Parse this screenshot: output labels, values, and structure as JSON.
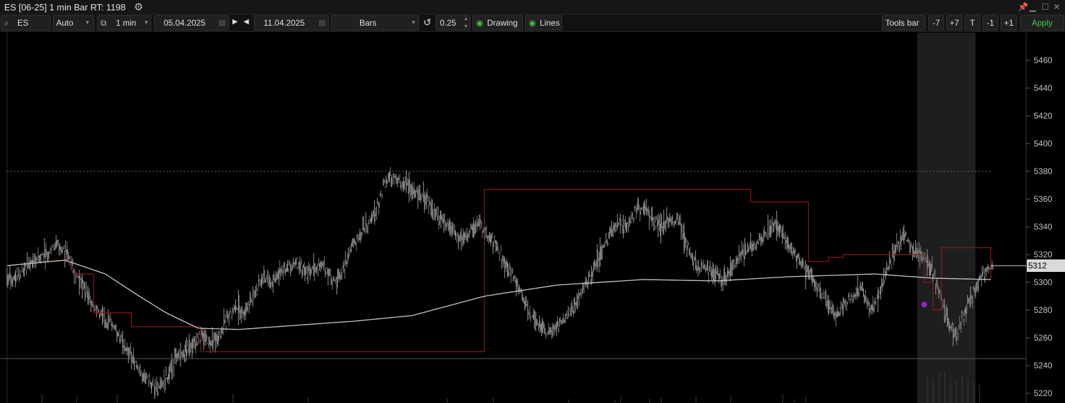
{
  "window": {
    "title": "ES [06-25] 1 min Bar RT: 1198",
    "settings_icon": "gears-icon"
  },
  "toolbar": {
    "symbol": "ES",
    "account": "Auto",
    "timeframe": "1 min",
    "date_from": "05.04.2025",
    "date_to": "11.04.2025",
    "chart_type": "Bars",
    "tick_size": "0.25",
    "drawing_label": "Drawing",
    "lines_label": "Lines",
    "tools_bar_label": "Tools bar",
    "nav_minus7": "-7",
    "nav_plus7": "+7",
    "nav_t": "T",
    "nav_minus1": "-1",
    "nav_plus1": "+1",
    "apply_label": "Apply"
  },
  "colors": {
    "background": "#000000",
    "bars": "#9a9a9a",
    "vwap": "#c8c8c8",
    "levels": "#8b1a1a",
    "session_highlight": "#1e1e1e",
    "apply_text": "#46c946",
    "marker": "#a020c0"
  },
  "chart_data": {
    "type": "bar",
    "y_axis_ticks": [
      "5460",
      "5440",
      "5420",
      "5400",
      "5380",
      "5360",
      "5340",
      "5320",
      "5300",
      "5280",
      "5260",
      "5240",
      "5220"
    ],
    "ylim": [
      5212,
      5478
    ],
    "current_price_label": "5312",
    "current_price": 5312,
    "dotted_level": 5380,
    "horizontal_level": 5245,
    "price_path": [
      [
        0,
        5302
      ],
      [
        3,
        5305
      ],
      [
        6,
        5310
      ],
      [
        10,
        5318
      ],
      [
        14,
        5321
      ],
      [
        17,
        5328
      ],
      [
        20,
        5322
      ],
      [
        23,
        5308
      ],
      [
        26,
        5298
      ],
      [
        29,
        5285
      ],
      [
        33,
        5274
      ],
      [
        37,
        5268
      ],
      [
        40,
        5255
      ],
      [
        43,
        5245
      ],
      [
        46,
        5235
      ],
      [
        49,
        5228
      ],
      [
        52,
        5222
      ],
      [
        55,
        5233
      ],
      [
        58,
        5245
      ],
      [
        61,
        5250
      ],
      [
        64,
        5256
      ],
      [
        67,
        5262
      ],
      [
        70,
        5256
      ],
      [
        73,
        5260
      ],
      [
        76,
        5275
      ],
      [
        79,
        5283
      ],
      [
        82,
        5280
      ],
      [
        85,
        5290
      ],
      [
        88,
        5304
      ],
      [
        91,
        5300
      ],
      [
        94,
        5307
      ],
      [
        97,
        5312
      ],
      [
        100,
        5314
      ],
      [
        103,
        5306
      ],
      [
        106,
        5310
      ],
      [
        109,
        5313
      ],
      [
        112,
        5300
      ],
      [
        115,
        5305
      ],
      [
        118,
        5322
      ],
      [
        121,
        5332
      ],
      [
        124,
        5342
      ],
      [
        127,
        5350
      ],
      [
        130,
        5370
      ],
      [
        133,
        5377
      ],
      [
        136,
        5372
      ],
      [
        139,
        5368
      ],
      [
        142,
        5364
      ],
      [
        145,
        5358
      ],
      [
        148,
        5350
      ],
      [
        151,
        5342
      ],
      [
        154,
        5336
      ],
      [
        157,
        5330
      ],
      [
        160,
        5338
      ],
      [
        163,
        5342
      ],
      [
        166,
        5333
      ],
      [
        169,
        5325
      ],
      [
        172,
        5312
      ],
      [
        175,
        5302
      ],
      [
        178,
        5288
      ],
      [
        181,
        5276
      ],
      [
        184,
        5268
      ],
      [
        187,
        5262
      ],
      [
        190,
        5268
      ],
      [
        193,
        5276
      ],
      [
        196,
        5284
      ],
      [
        199,
        5295
      ],
      [
        202,
        5306
      ],
      [
        205,
        5320
      ],
      [
        208,
        5335
      ],
      [
        211,
        5343
      ],
      [
        214,
        5340
      ],
      [
        217,
        5352
      ],
      [
        220,
        5354
      ],
      [
        223,
        5345
      ],
      [
        226,
        5340
      ],
      [
        229,
        5345
      ],
      [
        232,
        5343
      ],
      [
        235,
        5325
      ],
      [
        238,
        5310
      ],
      [
        241,
        5310
      ],
      [
        244,
        5307
      ],
      [
        247,
        5302
      ],
      [
        250,
        5310
      ],
      [
        253,
        5318
      ],
      [
        256,
        5325
      ],
      [
        259,
        5328
      ],
      [
        262,
        5335
      ],
      [
        265,
        5342
      ],
      [
        268,
        5334
      ],
      [
        271,
        5322
      ],
      [
        274,
        5315
      ],
      [
        277,
        5305
      ],
      [
        280,
        5296
      ],
      [
        283,
        5286
      ],
      [
        286,
        5275
      ],
      [
        289,
        5285
      ],
      [
        292,
        5290
      ],
      [
        295,
        5295
      ],
      [
        298,
        5280
      ],
      [
        301,
        5290
      ],
      [
        304,
        5310
      ],
      [
        307,
        5326
      ],
      [
        310,
        5334
      ],
      [
        313,
        5323
      ],
      [
        316,
        5318
      ],
      [
        319,
        5312
      ],
      [
        322,
        5292
      ],
      [
        325,
        5270
      ],
      [
        328,
        5262
      ],
      [
        331,
        5280
      ],
      [
        334,
        5295
      ],
      [
        337,
        5306
      ],
      [
        340,
        5312
      ]
    ],
    "price_noise": 11,
    "vwap_path": [
      [
        0,
        5312
      ],
      [
        20,
        5316
      ],
      [
        34,
        5306
      ],
      [
        45,
        5291
      ],
      [
        55,
        5278
      ],
      [
        66,
        5267
      ],
      [
        80,
        5266
      ],
      [
        100,
        5269
      ],
      [
        120,
        5272
      ],
      [
        140,
        5276
      ],
      [
        165,
        5290
      ],
      [
        190,
        5298
      ],
      [
        220,
        5302
      ],
      [
        245,
        5301
      ],
      [
        270,
        5304
      ],
      [
        300,
        5306
      ],
      [
        320,
        5303
      ],
      [
        340,
        5302
      ]
    ],
    "level_step_path": [
      [
        0,
        5312
      ],
      [
        21,
        5316
      ],
      [
        23,
        5306
      ],
      [
        30,
        5306
      ],
      [
        30,
        5278
      ],
      [
        43,
        5278
      ],
      [
        43,
        5268
      ],
      [
        67,
        5268
      ],
      [
        67,
        5250
      ],
      [
        165,
        5250
      ],
      [
        165,
        5367
      ],
      [
        257,
        5367
      ],
      [
        257,
        5358
      ],
      [
        277,
        5358
      ],
      [
        277,
        5315
      ],
      [
        284,
        5315
      ],
      [
        284,
        5318
      ],
      [
        289,
        5318
      ],
      [
        289,
        5320
      ],
      [
        317,
        5320
      ],
      [
        317,
        5300
      ],
      [
        320,
        5300
      ],
      [
        320,
        5280
      ],
      [
        323,
        5280
      ],
      [
        323,
        5325
      ],
      [
        340,
        5325
      ],
      [
        340,
        5302
      ]
    ],
    "session_highlight_range": [
      317,
      337
    ],
    "purple_marker": [
      317,
      5284
    ],
    "x_count": 341,
    "volume_heights": [
      0.3,
      0.5,
      0.7,
      0.9,
      1.0,
      0.8,
      0.9,
      1.0,
      0.7,
      0.6,
      0.9,
      1.0,
      0.8,
      0.6,
      0.9,
      1.0,
      0.7,
      0.5,
      0.8,
      0.6,
      0.4
    ]
  }
}
